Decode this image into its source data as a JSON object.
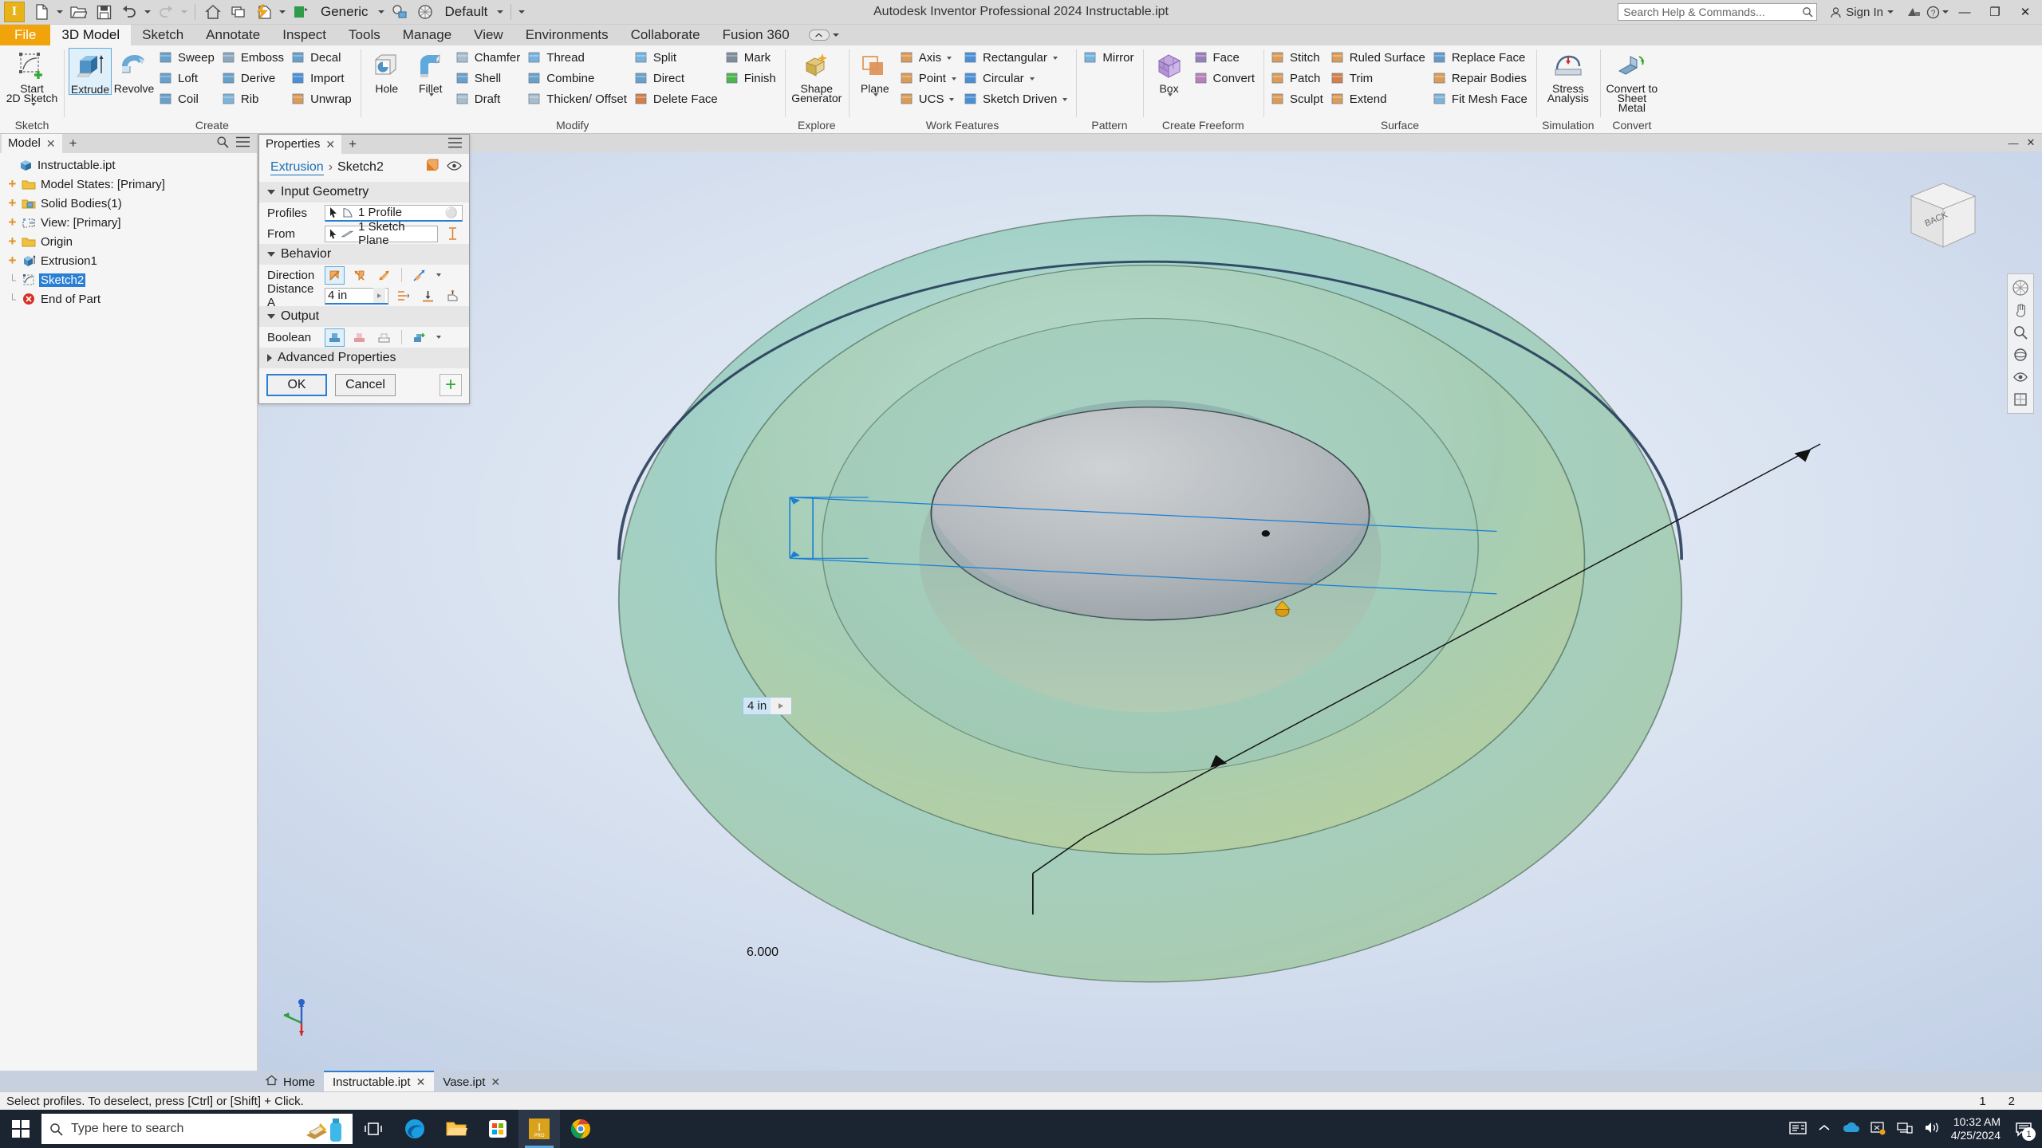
{
  "window": {
    "title": "Autodesk Inventor Professional 2024   Instructable.ipt",
    "app_initial": "I",
    "minimize": "—",
    "maximize": "❐",
    "close": "✕"
  },
  "quick_access": {
    "material_label": "Generic",
    "appearance_label": "Default"
  },
  "title_right": {
    "search_placeholder": "Search Help & Commands...",
    "sign_in": "Sign In"
  },
  "menu_tabs": [
    {
      "label": "File",
      "kind": "file"
    },
    {
      "label": "3D Model",
      "kind": "active"
    },
    {
      "label": "Sketch",
      "kind": "normal"
    },
    {
      "label": "Annotate",
      "kind": "normal"
    },
    {
      "label": "Inspect",
      "kind": "normal"
    },
    {
      "label": "Tools",
      "kind": "normal"
    },
    {
      "label": "Manage",
      "kind": "normal"
    },
    {
      "label": "View",
      "kind": "normal"
    },
    {
      "label": "Environments",
      "kind": "normal"
    },
    {
      "label": "Collaborate",
      "kind": "normal"
    },
    {
      "label": "Fusion 360",
      "kind": "normal"
    }
  ],
  "ribbon": {
    "groups": [
      {
        "label": "Sketch",
        "big": [
          {
            "label": "Start\n2D Sketch",
            "icon": "start-2d-sketch-icon",
            "dropdown": true
          }
        ],
        "columns": []
      },
      {
        "label": "Create",
        "big": [
          {
            "label": "Extrude",
            "icon": "extrude-icon",
            "selected": true
          },
          {
            "label": "Revolve",
            "icon": "revolve-icon"
          }
        ],
        "columns": [
          [
            "Sweep",
            "Loft",
            "Coil"
          ],
          [
            "Emboss",
            "Derive",
            "Rib"
          ],
          [
            "Decal",
            "Import",
            "Unwrap"
          ]
        ]
      },
      {
        "label": "Modify",
        "big": [
          {
            "label": "Hole",
            "icon": "hole-icon"
          },
          {
            "label": "Fillet",
            "icon": "fillet-icon",
            "dropdown": true
          }
        ],
        "columns": [
          [
            "Chamfer",
            "Shell",
            "Draft"
          ],
          [
            "Thread",
            "Combine",
            "Thicken/ Offset"
          ],
          [
            "Split",
            "Direct",
            "Delete Face"
          ],
          [
            "Mark",
            "Finish"
          ]
        ]
      },
      {
        "label": "Explore",
        "big": [
          {
            "label": "Shape\nGenerator",
            "icon": "shape-generator-icon"
          }
        ],
        "columns": []
      },
      {
        "label": "Work Features",
        "big": [
          {
            "label": "Plane",
            "icon": "plane-icon",
            "dropdown": true
          }
        ],
        "columns": [
          [
            "Axis",
            "Point",
            "UCS"
          ],
          [
            "Rectangular",
            "Circular",
            "Sketch Driven"
          ]
        ]
      },
      {
        "label": "Pattern",
        "big": [],
        "columns": [
          [
            "Mirror"
          ]
        ]
      },
      {
        "label": "Create Freeform",
        "big": [
          {
            "label": "Box",
            "icon": "freeform-box-icon",
            "dropdown": true
          }
        ],
        "columns": [
          [
            "Face",
            "Convert"
          ]
        ]
      },
      {
        "label": "Surface",
        "big": [],
        "columns": [
          [
            "Stitch",
            "Patch",
            "Sculpt"
          ],
          [
            "Ruled Surface",
            "Trim",
            "Extend"
          ],
          [
            "Replace Face",
            "Repair Bodies",
            "Fit Mesh Face"
          ]
        ]
      },
      {
        "label": "Simulation",
        "big": [
          {
            "label": "Stress\nAnalysis",
            "icon": "stress-analysis-icon"
          }
        ],
        "columns": []
      },
      {
        "label": "Convert",
        "big": [
          {
            "label": "Convert to\nSheet Metal",
            "icon": "convert-sheet-metal-icon"
          }
        ],
        "columns": []
      }
    ]
  },
  "browser": {
    "tab_label": "Model",
    "close_glyph": "✕",
    "plus_glyph": "+",
    "tree": [
      {
        "label": "Instructable.ipt",
        "icon": "part-icon",
        "expander": "none",
        "indent": 0
      },
      {
        "label": "Model States: [Primary]",
        "icon": "folder-icon",
        "expander": "plus",
        "indent": 1
      },
      {
        "label": "Solid Bodies(1)",
        "icon": "solid-bodies-folder-icon",
        "expander": "plus",
        "indent": 1
      },
      {
        "label": "View: [Primary]",
        "icon": "view-icon",
        "expander": "plus",
        "indent": 1
      },
      {
        "label": "Origin",
        "icon": "folder-icon",
        "expander": "plus",
        "indent": 1
      },
      {
        "label": "Extrusion1",
        "icon": "extrusion-icon",
        "expander": "plus",
        "indent": 1
      },
      {
        "label": "Sketch2",
        "icon": "sketch-icon",
        "expander": "dash",
        "indent": 1,
        "selected": true
      },
      {
        "label": "End of Part",
        "icon": "end-of-part-icon",
        "expander": "dash",
        "indent": 1
      }
    ]
  },
  "properties": {
    "tab_label": "Properties",
    "close_glyph": "✕",
    "plus_glyph": "+",
    "breadcrumb_link": "Extrusion",
    "breadcrumb_sep": "›",
    "breadcrumb_current": "Sketch2",
    "sections": {
      "input_geometry": {
        "title": "Input Geometry",
        "profiles_label": "Profiles",
        "profiles_value": "1 Profile",
        "from_label": "From",
        "from_value": "1 Sketch Plane"
      },
      "behavior": {
        "title": "Behavior",
        "direction_label": "Direction",
        "distance_label": "Distance A",
        "distance_value": "4 in"
      },
      "output": {
        "title": "Output",
        "boolean_label": "Boolean"
      },
      "advanced": {
        "title": "Advanced Properties"
      }
    },
    "ok_label": "OK",
    "cancel_label": "Cancel",
    "add_glyph": "+"
  },
  "viewport": {
    "dimension_edit_value": "4 in",
    "dimension_static": "6.000",
    "viewcube_label": "BACK"
  },
  "doc_tabs": [
    {
      "label": "Home",
      "icon": "home-icon",
      "closeable": false,
      "active": false
    },
    {
      "label": "Instructable.ipt",
      "closeable": true,
      "active": true
    },
    {
      "label": "Vase.ipt",
      "closeable": true,
      "active": false
    }
  ],
  "status": {
    "message": "Select profiles. To deselect, press [Ctrl] or [Shift] + Click.",
    "right_items": [
      "1",
      "2"
    ]
  },
  "taskbar": {
    "search_placeholder": "Type here to search",
    "time": "10:32 AM",
    "date": "4/25/2024",
    "notification_count": "1"
  },
  "colors": {
    "accent": "#2a7fd4",
    "file_tab": "#f0a30a",
    "selection": "#2a7fd4",
    "ribbon_bg": "#f5f5f5",
    "chrome_bg": "#d9d9d9"
  }
}
